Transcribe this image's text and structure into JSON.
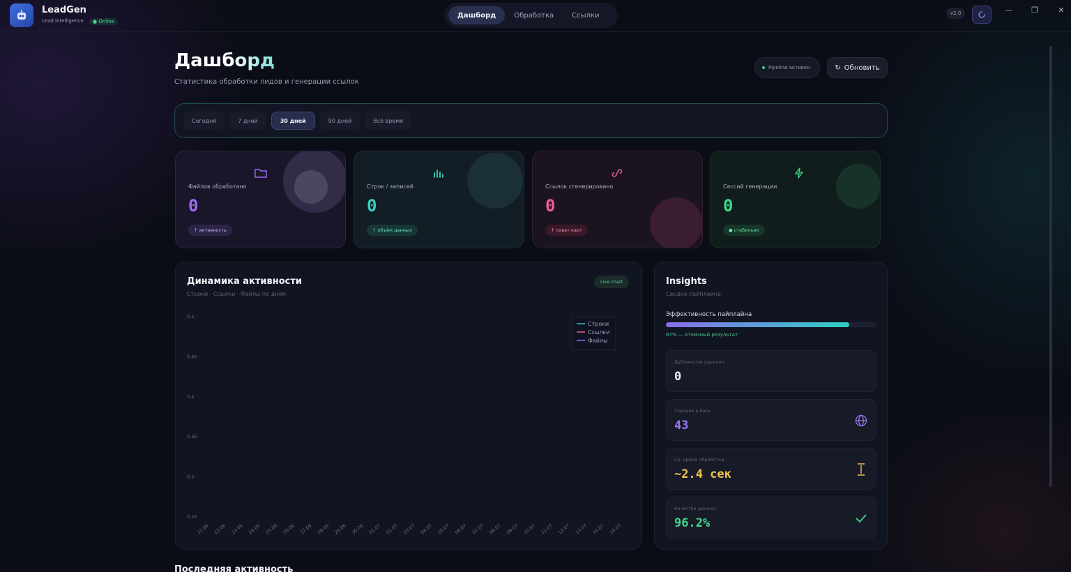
{
  "app": {
    "name": "LeadGen",
    "subtitle": "Lead Intelligence",
    "status": "● Online",
    "version": "v2.0"
  },
  "nav": {
    "tabs": [
      {
        "label": "Дашборд",
        "active": true
      },
      {
        "label": "Обработка",
        "active": false
      },
      {
        "label": "Ссылки",
        "active": false
      }
    ]
  },
  "window_controls": {
    "minimize": "—",
    "maximize": "❐",
    "close": "✕"
  },
  "header": {
    "title": "Дашборд",
    "subtitle": "Статистика обработки лидов и генерации ссылок",
    "pipeline": "Pipeline активен",
    "refresh": "Обновить"
  },
  "periods": [
    {
      "label": "Сегодня",
      "active": false
    },
    {
      "label": "7 дней",
      "active": false
    },
    {
      "label": "30 дней",
      "active": true
    },
    {
      "label": "90 дней",
      "active": false
    },
    {
      "label": "Всё время",
      "active": false
    }
  ],
  "stats": [
    {
      "label": "Файлов обработано",
      "value": "0",
      "chip": "↑ активность",
      "icon": "folder-icon",
      "color": "#9b6cf5"
    },
    {
      "label": "Строк / записей",
      "value": "0",
      "chip": "↑ объём данных",
      "icon": "bar-chart-icon",
      "color": "#34d3c1"
    },
    {
      "label": "Ссылок сгенерировано",
      "value": "0",
      "chip": "↑ охват карт",
      "icon": "link-icon",
      "color": "#ec5f91"
    },
    {
      "label": "Сессий генерации",
      "value": "0",
      "chip": "● стабильно",
      "icon": "lightning-icon",
      "color": "#3fd88c"
    }
  ],
  "activity_chart": {
    "title": "Динамика активности",
    "subtitle": "Строки · Ссылки · Файлы по дням",
    "badge": "Live chart"
  },
  "chart_data": {
    "type": "line",
    "title": "Динамика активности",
    "x": [
      "21.06",
      "22.06",
      "23.06",
      "24.06",
      "25.06",
      "26.06",
      "27.06",
      "28.06",
      "29.06",
      "30.06",
      "01.07",
      "02.07",
      "03.07",
      "04.07",
      "05.07",
      "06.07",
      "07.07",
      "08.07",
      "09.07",
      "10.07",
      "11.07",
      "12.07",
      "13.07",
      "14.07",
      "15.07"
    ],
    "yticks": [
      "0.5",
      "0.45",
      "0.4",
      "0.35",
      "0.3",
      "0.25"
    ],
    "ylim": [
      0.25,
      0.5
    ],
    "series": [
      {
        "name": "Строки",
        "color": "#2fc7b7",
        "values": []
      },
      {
        "name": "Ссылки",
        "color": "#e05a8e",
        "values": []
      },
      {
        "name": "Файлы",
        "color": "#8a6cf2",
        "values": []
      }
    ],
    "legend": "top-right",
    "grid": false
  },
  "insights": {
    "title": "Insights",
    "subtitle": "Сводка пайплайна",
    "efficiency_label": "Эффективность пайплайна",
    "efficiency_value": 0.87,
    "efficiency_note": "87% — отличный результат",
    "boxes": [
      {
        "label": "Дубликатов удалено",
        "value": "0",
        "color": "#eef0f7",
        "icon": ""
      },
      {
        "label": "Городов в базе",
        "value": "43",
        "color": "#9a78f4",
        "icon": "globe-icon"
      },
      {
        "label": "Ср. время обработки",
        "value": "~2.4 сек",
        "color": "#f2c14a",
        "icon": "hourglass-icon"
      },
      {
        "label": "Качество данных",
        "value": "96.2%",
        "color": "#3fd88c",
        "icon": "check-icon"
      }
    ]
  },
  "recent": {
    "title": "Последняя активность"
  }
}
